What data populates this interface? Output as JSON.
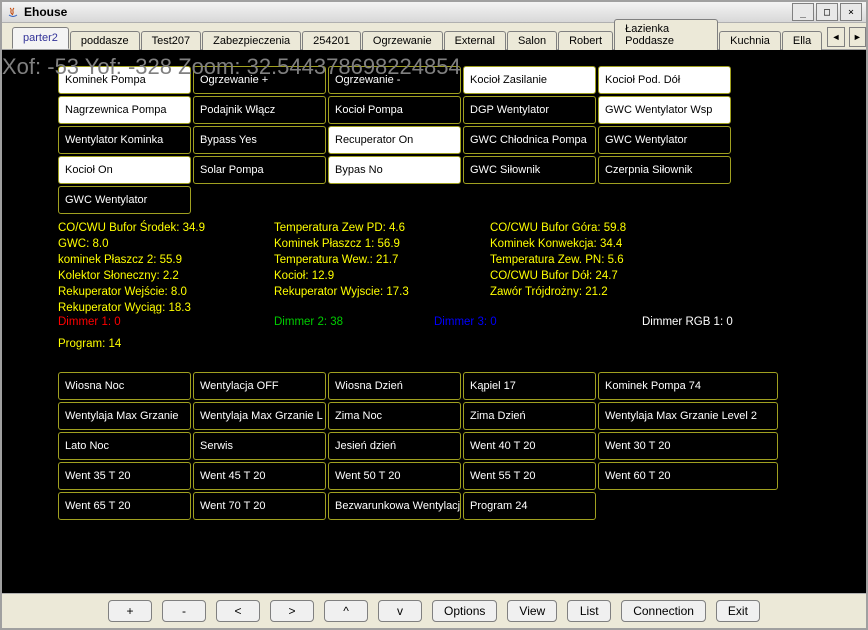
{
  "window": {
    "title": "Ehouse"
  },
  "tabs": [
    {
      "label": "parter2",
      "active": true
    },
    {
      "label": "poddasze"
    },
    {
      "label": "Test207"
    },
    {
      "label": "Zabezpieczenia"
    },
    {
      "label": "254201"
    },
    {
      "label": "Ogrzewanie"
    },
    {
      "label": "External"
    },
    {
      "label": "Salon"
    },
    {
      "label": "Robert"
    },
    {
      "label": "Łazienka Poddasze"
    },
    {
      "label": "Kuchnia"
    },
    {
      "label": "Ella"
    }
  ],
  "overlay": "Xof: -53 Yof: -328 Zoom: 32.544378698224854",
  "state_buttons": [
    {
      "label": "Kominek Pompa",
      "on": true
    },
    {
      "label": "Ogrzewanie +"
    },
    {
      "label": "Ogrzewanie -"
    },
    {
      "label": "Kocioł Zasilanie",
      "on": true
    },
    {
      "label": "Kocioł Pod. Dół",
      "on": true
    },
    {
      "label": "Nagrzewnica Pompa",
      "on": true
    },
    {
      "label": "Podajnik Włącz"
    },
    {
      "label": "Kocioł Pompa"
    },
    {
      "label": "DGP Wentylator"
    },
    {
      "label": "GWC Wentylator Wsp",
      "on": true
    },
    {
      "label": "Wentylator Kominka"
    },
    {
      "label": "Bypass Yes"
    },
    {
      "label": "Recuperator On",
      "on": true
    },
    {
      "label": "GWC Chłodnica Pompa"
    },
    {
      "label": "GWC Wentylator"
    },
    {
      "label": "Kocioł On",
      "on": true
    },
    {
      "label": "Solar Pompa"
    },
    {
      "label": "Bypas No",
      "on": true
    },
    {
      "label": "GWC Siłownik"
    },
    {
      "label": "Czerpnia Siłownik"
    },
    {
      "label": "GWC Wentylator"
    }
  ],
  "status": {
    "col1": [
      "CO/CWU Bufor Środek: 34.9",
      "GWC: 8.0",
      "kominek Płaszcz 2: 55.9",
      "Kolektor Słoneczny: 2.2",
      "Rekuperator Wejście: 8.0",
      "Rekuperator Wyciąg: 18.3"
    ],
    "col2": [
      "Temperatura Zew PD: 4.6",
      "Kominek Płaszcz 1: 56.9",
      "Temperatura Wew.: 21.7",
      "Kocioł: 12.9",
      "Rekuperator Wyjscie: 17.3"
    ],
    "col3": [
      "CO/CWU Bufor Góra: 59.8",
      "Kominek Konwekcja: 34.4",
      "Temperatura Zew. PN: 5.6",
      "CO/CWU Bufor Dół: 24.7",
      "Zawór Trójdrożny: 21.2"
    ]
  },
  "dimmers": {
    "d1": "Dimmer 1: 0",
    "d2": "Dimmer 2: 38",
    "d3": "Dimmer 3: 0",
    "d4": "Dimmer RGB 1: 0"
  },
  "program_line": "Program: 14",
  "programs": [
    "Wiosna Noc",
    "Wentylacja OFF",
    "Wiosna Dzień",
    "Kąpiel 17",
    "Kominek Pompa 74",
    "Wentylaja Max Grzanie",
    "Wentylaja Max Grzanie L",
    "Zima Noc",
    "Zima Dzień",
    "Wentylaja Max Grzanie Level 2",
    "Lato Noc",
    "Serwis",
    "Jesień dzień",
    "Went 40 T 20",
    "Went 30 T 20",
    "Went 35 T 20",
    "Went 45 T 20",
    "Went 50 T 20",
    "Went 55 T 20",
    "Went 60 T 20",
    "Went 65 T 20",
    "Went 70 T 20",
    "Bezwarunkowa Wentylacja",
    "Program 24"
  ],
  "bottom": [
    "+",
    "-",
    "<",
    ">",
    "^",
    "v",
    "Options",
    "View",
    "List",
    "Connection",
    "Exit"
  ]
}
